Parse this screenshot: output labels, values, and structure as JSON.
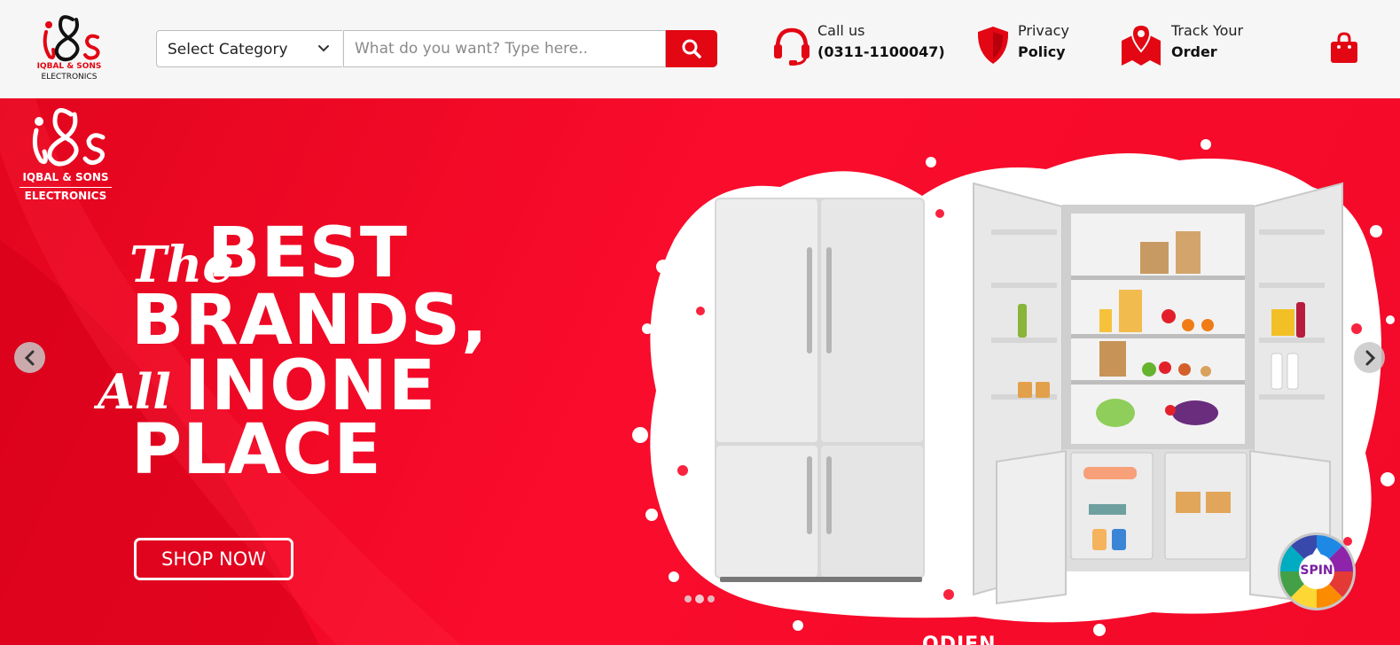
{
  "header": {
    "logo": {
      "mark": "i&s",
      "line1": "IQBAL & SONS",
      "line2": "ELECTRONICS"
    },
    "category_select": {
      "selected": "Select Category",
      "icon": "chevron-down-icon"
    },
    "search": {
      "placeholder": "What do you want? Type here..",
      "value": "",
      "button_icon": "search-icon"
    },
    "call": {
      "label": "Call us",
      "value": "(0311-1100047)",
      "icon": "headset-icon"
    },
    "privacy": {
      "label": "Privacy",
      "value": "Policy",
      "icon": "shield-icon"
    },
    "track": {
      "label": "Track Your",
      "value": "Order",
      "icon": "map-pin-icon"
    },
    "cart_icon": "shopping-bag-icon"
  },
  "hero": {
    "logo": {
      "mark": "i&s",
      "line1": "IQBAL & SONS",
      "line2": "ELECTRONICS"
    },
    "headline": {
      "the": "The",
      "best": "BEST",
      "brands": "BRANDS,",
      "all": "All",
      "inone": "INONE",
      "place": "PLACE"
    },
    "cta_label": "SHOP NOW",
    "slides_total": 3,
    "active_slide": 2,
    "spin_label": "SPIN",
    "brand_strip": "ODIEN"
  },
  "colors": {
    "brand_red": "#e30613",
    "hero_red": "#f80b2a",
    "header_bg": "#f6f6f6",
    "white": "#ffffff"
  }
}
